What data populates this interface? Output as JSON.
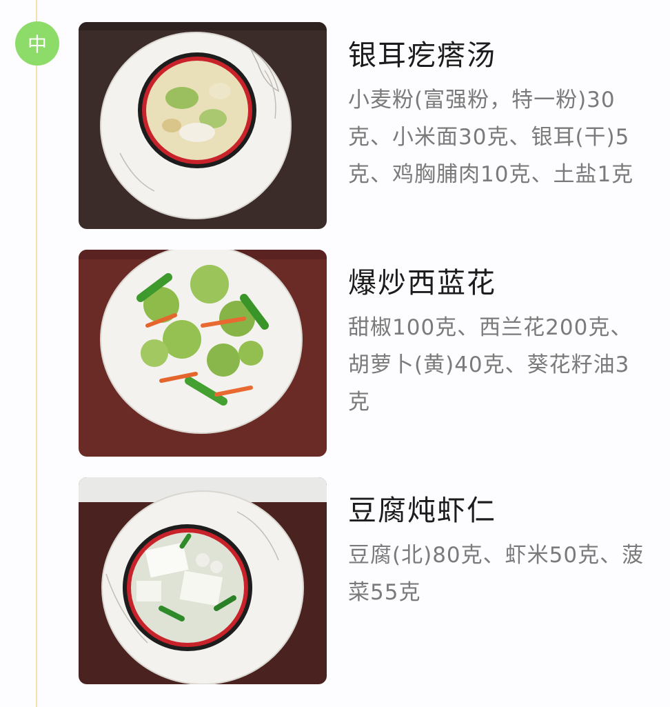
{
  "meal": {
    "badge_label": "中"
  },
  "colors": {
    "badge": "#8ddc6a",
    "timeline": "#f3dfb4",
    "title": "#1c1c1c",
    "ingredients": "#7a7a7a"
  },
  "dishes": [
    {
      "title": "银耳疙瘩汤",
      "ingredients": "小麦粉(富强粉，特一粉)30克、小米面30克、银耳(干)5克、鸡胸脯肉10克、土盐1克"
    },
    {
      "title": "爆炒西蓝花",
      "ingredients": "甜椒100克、西兰花200克、胡萝卜(黄)40克、葵花籽油3克"
    },
    {
      "title": "豆腐炖虾仁",
      "ingredients": "豆腐(北)80克、虾米50克、菠菜55克"
    }
  ]
}
